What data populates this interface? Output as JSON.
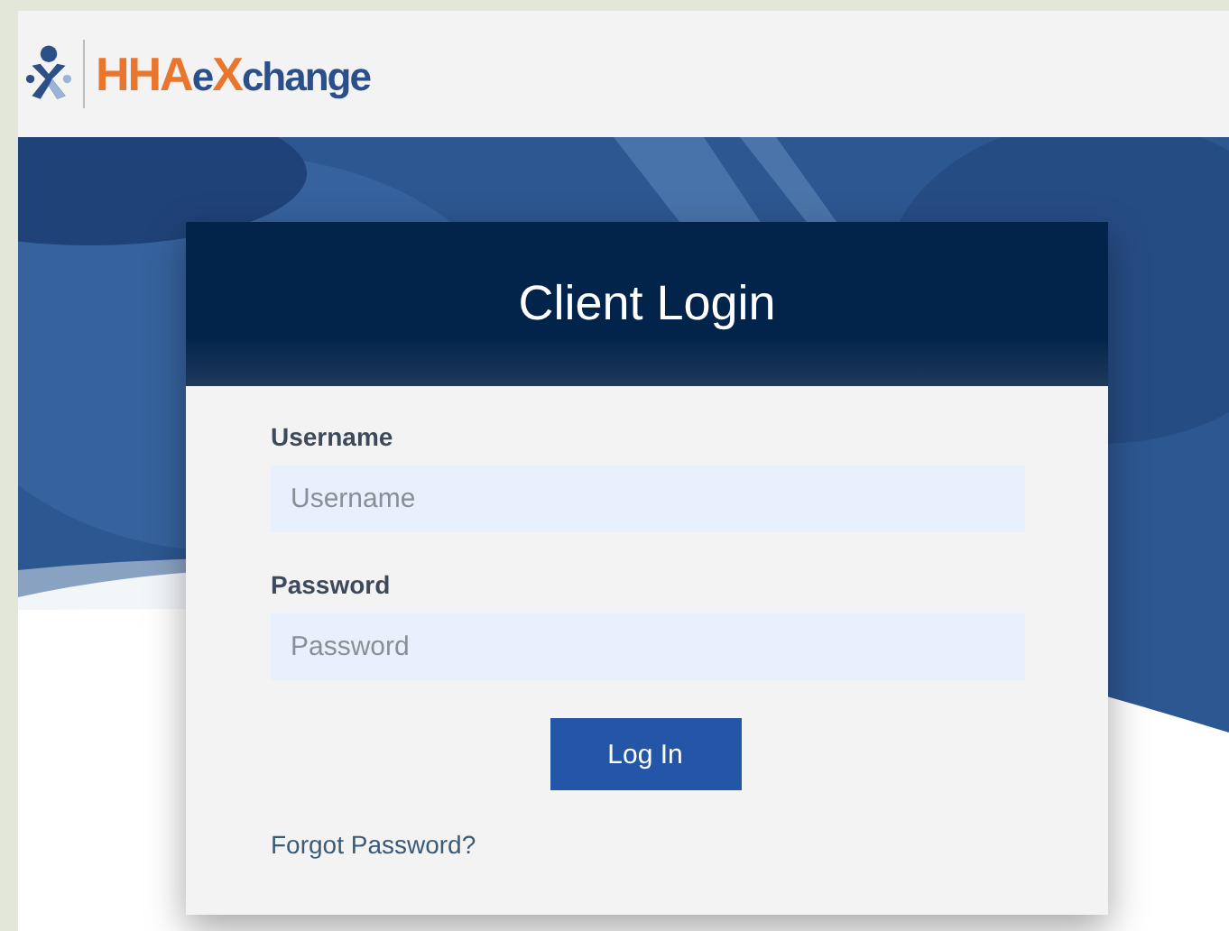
{
  "logo": {
    "parts": [
      {
        "text": "HHA",
        "kind": "accent"
      },
      {
        "text": "e",
        "kind": "plain"
      },
      {
        "text": "X",
        "kind": "accent"
      },
      {
        "text": "change",
        "kind": "plain"
      }
    ]
  },
  "login": {
    "title": "Client Login",
    "fields": [
      {
        "label": "Username",
        "placeholder": "Username"
      },
      {
        "label": "Password",
        "placeholder": "Password"
      }
    ],
    "button": "Log In",
    "link": "Forgot Password?"
  }
}
